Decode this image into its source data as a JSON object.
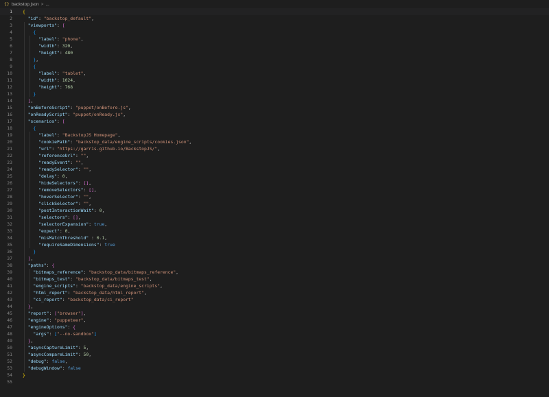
{
  "breadcrumb": {
    "icon": "json-file-icon",
    "file_name": "backstop.json",
    "separator": ">",
    "ellipsis": "..."
  },
  "editor": {
    "current_line": 1,
    "colors": {
      "background": "#1e1e1e",
      "key": "#9cdcfe",
      "string": "#ce9178",
      "number": "#b5cea8",
      "boolean": "#569cd6",
      "line_number": "#858585"
    },
    "lines": [
      {
        "n": "1",
        "tokens": [
          {
            "t": "{",
            "c": "y"
          }
        ]
      },
      {
        "n": "2",
        "tokens": [
          {
            "t": "  "
          },
          {
            "t": "\"id\"",
            "c": "k"
          },
          {
            "t": ": "
          },
          {
            "t": "\"backstop_default\"",
            "c": "s"
          },
          {
            "t": ","
          }
        ]
      },
      {
        "n": "3",
        "tokens": [
          {
            "t": "  "
          },
          {
            "t": "\"viewports\"",
            "c": "k"
          },
          {
            "t": ": "
          },
          {
            "t": "[",
            "c": "m"
          }
        ]
      },
      {
        "n": "4",
        "tokens": [
          {
            "t": "    "
          },
          {
            "t": "{",
            "c": "c"
          }
        ]
      },
      {
        "n": "5",
        "tokens": [
          {
            "t": "      "
          },
          {
            "t": "\"label\"",
            "c": "k"
          },
          {
            "t": ": "
          },
          {
            "t": "\"phone\"",
            "c": "s"
          },
          {
            "t": ","
          }
        ]
      },
      {
        "n": "6",
        "tokens": [
          {
            "t": "      "
          },
          {
            "t": "\"width\"",
            "c": "k"
          },
          {
            "t": ": "
          },
          {
            "t": "320",
            "c": "n"
          },
          {
            "t": ","
          }
        ]
      },
      {
        "n": "7",
        "tokens": [
          {
            "t": "      "
          },
          {
            "t": "\"height\"",
            "c": "k"
          },
          {
            "t": ": "
          },
          {
            "t": "480",
            "c": "n"
          }
        ]
      },
      {
        "n": "8",
        "tokens": [
          {
            "t": "    "
          },
          {
            "t": "}",
            "c": "c"
          },
          {
            "t": ","
          }
        ]
      },
      {
        "n": "9",
        "tokens": [
          {
            "t": "    "
          },
          {
            "t": "{",
            "c": "c"
          }
        ]
      },
      {
        "n": "10",
        "tokens": [
          {
            "t": "      "
          },
          {
            "t": "\"label\"",
            "c": "k"
          },
          {
            "t": ": "
          },
          {
            "t": "\"tablet\"",
            "c": "s"
          },
          {
            "t": ","
          }
        ]
      },
      {
        "n": "11",
        "tokens": [
          {
            "t": "      "
          },
          {
            "t": "\"width\"",
            "c": "k"
          },
          {
            "t": ": "
          },
          {
            "t": "1024",
            "c": "n"
          },
          {
            "t": ","
          }
        ]
      },
      {
        "n": "12",
        "tokens": [
          {
            "t": "      "
          },
          {
            "t": "\"height\"",
            "c": "k"
          },
          {
            "t": ": "
          },
          {
            "t": "768",
            "c": "n"
          }
        ]
      },
      {
        "n": "13",
        "tokens": [
          {
            "t": "    "
          },
          {
            "t": "}",
            "c": "c"
          }
        ]
      },
      {
        "n": "14",
        "tokens": [
          {
            "t": "  "
          },
          {
            "t": "]",
            "c": "m"
          },
          {
            "t": ","
          }
        ]
      },
      {
        "n": "15",
        "tokens": [
          {
            "t": "  "
          },
          {
            "t": "\"onBeforeScript\"",
            "c": "k"
          },
          {
            "t": ": "
          },
          {
            "t": "\"puppet/onBefore.js\"",
            "c": "s"
          },
          {
            "t": ","
          }
        ]
      },
      {
        "n": "16",
        "tokens": [
          {
            "t": "  "
          },
          {
            "t": "\"onReadyScript\"",
            "c": "k"
          },
          {
            "t": ": "
          },
          {
            "t": "\"puppet/onReady.js\"",
            "c": "s"
          },
          {
            "t": ","
          }
        ]
      },
      {
        "n": "17",
        "tokens": [
          {
            "t": "  "
          },
          {
            "t": "\"scenarios\"",
            "c": "k"
          },
          {
            "t": ": "
          },
          {
            "t": "[",
            "c": "m"
          }
        ]
      },
      {
        "n": "18",
        "tokens": [
          {
            "t": "    "
          },
          {
            "t": "{",
            "c": "c"
          }
        ]
      },
      {
        "n": "19",
        "tokens": [
          {
            "t": "      "
          },
          {
            "t": "\"label\"",
            "c": "k"
          },
          {
            "t": ": "
          },
          {
            "t": "\"BackstopJS Homepage\"",
            "c": "s"
          },
          {
            "t": ","
          }
        ]
      },
      {
        "n": "20",
        "tokens": [
          {
            "t": "      "
          },
          {
            "t": "\"cookiePath\"",
            "c": "k"
          },
          {
            "t": ": "
          },
          {
            "t": "\"backstop_data/engine_scripts/cookies.json\"",
            "c": "s"
          },
          {
            "t": ","
          }
        ]
      },
      {
        "n": "21",
        "tokens": [
          {
            "t": "      "
          },
          {
            "t": "\"url\"",
            "c": "k"
          },
          {
            "t": ": "
          },
          {
            "t": "\"https://garris.github.io/BackstopJS/\"",
            "c": "s"
          },
          {
            "t": ","
          }
        ]
      },
      {
        "n": "22",
        "tokens": [
          {
            "t": "      "
          },
          {
            "t": "\"referenceUrl\"",
            "c": "k"
          },
          {
            "t": ": "
          },
          {
            "t": "\"\"",
            "c": "s"
          },
          {
            "t": ","
          }
        ]
      },
      {
        "n": "23",
        "tokens": [
          {
            "t": "      "
          },
          {
            "t": "\"readyEvent\"",
            "c": "k"
          },
          {
            "t": ": "
          },
          {
            "t": "\"\"",
            "c": "s"
          },
          {
            "t": ","
          }
        ]
      },
      {
        "n": "24",
        "tokens": [
          {
            "t": "      "
          },
          {
            "t": "\"readySelector\"",
            "c": "k"
          },
          {
            "t": ": "
          },
          {
            "t": "\"\"",
            "c": "s"
          },
          {
            "t": ","
          }
        ]
      },
      {
        "n": "25",
        "tokens": [
          {
            "t": "      "
          },
          {
            "t": "\"delay\"",
            "c": "k"
          },
          {
            "t": ": "
          },
          {
            "t": "0",
            "c": "n"
          },
          {
            "t": ","
          }
        ]
      },
      {
        "n": "26",
        "tokens": [
          {
            "t": "      "
          },
          {
            "t": "\"hideSelectors\"",
            "c": "k"
          },
          {
            "t": ": "
          },
          {
            "t": "[]",
            "c": "m"
          },
          {
            "t": ","
          }
        ]
      },
      {
        "n": "27",
        "tokens": [
          {
            "t": "      "
          },
          {
            "t": "\"removeSelectors\"",
            "c": "k"
          },
          {
            "t": ": "
          },
          {
            "t": "[]",
            "c": "m"
          },
          {
            "t": ","
          }
        ]
      },
      {
        "n": "28",
        "tokens": [
          {
            "t": "      "
          },
          {
            "t": "\"hoverSelector\"",
            "c": "k"
          },
          {
            "t": ": "
          },
          {
            "t": "\"\"",
            "c": "s"
          },
          {
            "t": ","
          }
        ]
      },
      {
        "n": "29",
        "tokens": [
          {
            "t": "      "
          },
          {
            "t": "\"clickSelector\"",
            "c": "k"
          },
          {
            "t": ": "
          },
          {
            "t": "\"\"",
            "c": "s"
          },
          {
            "t": ","
          }
        ]
      },
      {
        "n": "30",
        "tokens": [
          {
            "t": "      "
          },
          {
            "t": "\"postInteractionWait\"",
            "c": "k"
          },
          {
            "t": ": "
          },
          {
            "t": "0",
            "c": "n"
          },
          {
            "t": ","
          }
        ]
      },
      {
        "n": "31",
        "tokens": [
          {
            "t": "      "
          },
          {
            "t": "\"selectors\"",
            "c": "k"
          },
          {
            "t": ": "
          },
          {
            "t": "[]",
            "c": "m"
          },
          {
            "t": ","
          }
        ]
      },
      {
        "n": "32",
        "tokens": [
          {
            "t": "      "
          },
          {
            "t": "\"selectorExpansion\"",
            "c": "k"
          },
          {
            "t": ": "
          },
          {
            "t": "true",
            "c": "b"
          },
          {
            "t": ","
          }
        ]
      },
      {
        "n": "33",
        "tokens": [
          {
            "t": "      "
          },
          {
            "t": "\"expect\"",
            "c": "k"
          },
          {
            "t": ": "
          },
          {
            "t": "0",
            "c": "n"
          },
          {
            "t": ","
          }
        ]
      },
      {
        "n": "34",
        "tokens": [
          {
            "t": "      "
          },
          {
            "t": "\"misMatchThreshold\"",
            "c": "k"
          },
          {
            "t": " : "
          },
          {
            "t": "0.1",
            "c": "n"
          },
          {
            "t": ","
          }
        ]
      },
      {
        "n": "35",
        "tokens": [
          {
            "t": "      "
          },
          {
            "t": "\"requireSameDimensions\"",
            "c": "k"
          },
          {
            "t": ": "
          },
          {
            "t": "true",
            "c": "b"
          }
        ]
      },
      {
        "n": "36",
        "tokens": [
          {
            "t": "    "
          },
          {
            "t": "}",
            "c": "c"
          }
        ]
      },
      {
        "n": "37",
        "tokens": [
          {
            "t": "  "
          },
          {
            "t": "]",
            "c": "m"
          },
          {
            "t": ","
          }
        ]
      },
      {
        "n": "38",
        "tokens": [
          {
            "t": "  "
          },
          {
            "t": "\"paths\"",
            "c": "k"
          },
          {
            "t": ": "
          },
          {
            "t": "{",
            "c": "m"
          }
        ]
      },
      {
        "n": "39",
        "tokens": [
          {
            "t": "    "
          },
          {
            "t": "\"bitmaps_reference\"",
            "c": "k"
          },
          {
            "t": ": "
          },
          {
            "t": "\"backstop_data/bitmaps_reference\"",
            "c": "s"
          },
          {
            "t": ","
          }
        ]
      },
      {
        "n": "40",
        "tokens": [
          {
            "t": "    "
          },
          {
            "t": "\"bitmaps_test\"",
            "c": "k"
          },
          {
            "t": ": "
          },
          {
            "t": "\"backstop_data/bitmaps_test\"",
            "c": "s"
          },
          {
            "t": ","
          }
        ]
      },
      {
        "n": "41",
        "tokens": [
          {
            "t": "    "
          },
          {
            "t": "\"engine_scripts\"",
            "c": "k"
          },
          {
            "t": ": "
          },
          {
            "t": "\"backstop_data/engine_scripts\"",
            "c": "s"
          },
          {
            "t": ","
          }
        ]
      },
      {
        "n": "42",
        "tokens": [
          {
            "t": "    "
          },
          {
            "t": "\"html_report\"",
            "c": "k"
          },
          {
            "t": ": "
          },
          {
            "t": "\"backstop_data/html_report\"",
            "c": "s"
          },
          {
            "t": ","
          }
        ]
      },
      {
        "n": "43",
        "tokens": [
          {
            "t": "    "
          },
          {
            "t": "\"ci_report\"",
            "c": "k"
          },
          {
            "t": ": "
          },
          {
            "t": "\"backstop_data/ci_report\"",
            "c": "s"
          }
        ]
      },
      {
        "n": "44",
        "tokens": [
          {
            "t": "  "
          },
          {
            "t": "}",
            "c": "m"
          },
          {
            "t": ","
          }
        ]
      },
      {
        "n": "45",
        "tokens": [
          {
            "t": "  "
          },
          {
            "t": "\"report\"",
            "c": "k"
          },
          {
            "t": ": "
          },
          {
            "t": "[",
            "c": "m"
          },
          {
            "t": "\"browser\"",
            "c": "s"
          },
          {
            "t": "]",
            "c": "m"
          },
          {
            "t": ","
          }
        ]
      },
      {
        "n": "46",
        "tokens": [
          {
            "t": "  "
          },
          {
            "t": "\"engine\"",
            "c": "k"
          },
          {
            "t": ": "
          },
          {
            "t": "\"puppeteer\"",
            "c": "s"
          },
          {
            "t": ","
          }
        ]
      },
      {
        "n": "47",
        "tokens": [
          {
            "t": "  "
          },
          {
            "t": "\"engineOptions\"",
            "c": "k"
          },
          {
            "t": ": "
          },
          {
            "t": "{",
            "c": "m"
          }
        ]
      },
      {
        "n": "48",
        "tokens": [
          {
            "t": "    "
          },
          {
            "t": "\"args\"",
            "c": "k"
          },
          {
            "t": ": "
          },
          {
            "t": "[",
            "c": "c"
          },
          {
            "t": "\"--no-sandbox\"",
            "c": "s"
          },
          {
            "t": "]",
            "c": "c"
          }
        ]
      },
      {
        "n": "49",
        "tokens": [
          {
            "t": "  "
          },
          {
            "t": "}",
            "c": "m"
          },
          {
            "t": ","
          }
        ]
      },
      {
        "n": "50",
        "tokens": [
          {
            "t": "  "
          },
          {
            "t": "\"asyncCaptureLimit\"",
            "c": "k"
          },
          {
            "t": ": "
          },
          {
            "t": "5",
            "c": "n"
          },
          {
            "t": ","
          }
        ]
      },
      {
        "n": "51",
        "tokens": [
          {
            "t": "  "
          },
          {
            "t": "\"asyncCompareLimit\"",
            "c": "k"
          },
          {
            "t": ": "
          },
          {
            "t": "50",
            "c": "n"
          },
          {
            "t": ","
          }
        ]
      },
      {
        "n": "52",
        "tokens": [
          {
            "t": "  "
          },
          {
            "t": "\"debug\"",
            "c": "k"
          },
          {
            "t": ": "
          },
          {
            "t": "false",
            "c": "b"
          },
          {
            "t": ","
          }
        ]
      },
      {
        "n": "53",
        "tokens": [
          {
            "t": "  "
          },
          {
            "t": "\"debugWindow\"",
            "c": "k"
          },
          {
            "t": ": "
          },
          {
            "t": "false",
            "c": "b"
          }
        ]
      },
      {
        "n": "54",
        "tokens": [
          {
            "t": "}",
            "c": "y"
          }
        ]
      },
      {
        "n": "55",
        "tokens": []
      }
    ]
  }
}
